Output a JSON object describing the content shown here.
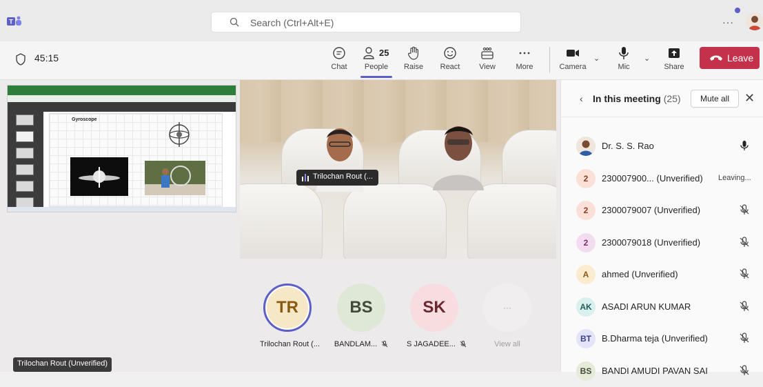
{
  "app": {
    "icon": "teams-logo-icon"
  },
  "search": {
    "placeholder": "Search (Ctrl+Alt+E)"
  },
  "meeting": {
    "timer": "45:15"
  },
  "toolbar": {
    "chat": "Chat",
    "people": "People",
    "people_count": "25",
    "raise": "Raise",
    "react": "React",
    "view": "View",
    "more": "More",
    "camera": "Camera",
    "mic": "Mic",
    "share": "Share",
    "leave": "Leave"
  },
  "stage": {
    "screenshare_name": "Trilochan Rout (Unverified)",
    "slide_title": "Gyroscope",
    "video_label": "Trilochan Rout (..."
  },
  "tiles": [
    {
      "initials": "TR",
      "name": "Trilochan Rout (...",
      "bg": "#f6e7c6",
      "fg": "#8a5a12",
      "muted": false
    },
    {
      "initials": "BS",
      "name": "BANDLAM...",
      "bg": "#dfe7d7",
      "fg": "#404a38",
      "muted": true
    },
    {
      "initials": "SK",
      "name": "S JAGADEE...",
      "bg": "#f8dde0",
      "fg": "#6b2730",
      "muted": true
    },
    {
      "initials": "···",
      "name": "View all",
      "bg": "#f0eeee",
      "fg": "#9e9e9e",
      "muted": false
    }
  ],
  "panel": {
    "title": "In this meeting",
    "count": "(25)",
    "mute_all": "Mute all",
    "participants": [
      {
        "initials": "",
        "name": "Dr. S. S. Rao",
        "status": "",
        "mic": "mic-on",
        "bg": "#e6d8cf",
        "fg": "#242424"
      },
      {
        "initials": "2",
        "name": "230007900...  (Unverified)",
        "status": "Leaving...",
        "mic": "",
        "bg": "#fbe0d8",
        "fg": "#8a3b22"
      },
      {
        "initials": "2",
        "name": "2300079007 (Unverified)",
        "status": "",
        "mic": "mic-off",
        "bg": "#fbe0d8",
        "fg": "#8a3b22"
      },
      {
        "initials": "2",
        "name": "2300079018 (Unverified)",
        "status": "",
        "mic": "mic-off",
        "bg": "#f3dcef",
        "fg": "#7a2d6d"
      },
      {
        "initials": "A",
        "name": "ahmed (Unverified)",
        "status": "",
        "mic": "mic-off",
        "bg": "#fbecd0",
        "fg": "#8a5a12"
      },
      {
        "initials": "AK",
        "name": "ASADI ARUN KUMAR",
        "status": "",
        "mic": "mic-off",
        "bg": "#d9f0ee",
        "fg": "#1f5f5a"
      },
      {
        "initials": "BT",
        "name": "B.Dharma teja (Unverified)",
        "status": "",
        "mic": "mic-off",
        "bg": "#e3e4f7",
        "fg": "#3b3f8a"
      },
      {
        "initials": "BS",
        "name": "BANDI AMUDI PAVAN SAI",
        "status": "",
        "mic": "mic-off",
        "bg": "#e5ebd9",
        "fg": "#404a38"
      }
    ]
  },
  "colors": {
    "accent": "#5b5fc7",
    "leave": "#c4314b"
  }
}
